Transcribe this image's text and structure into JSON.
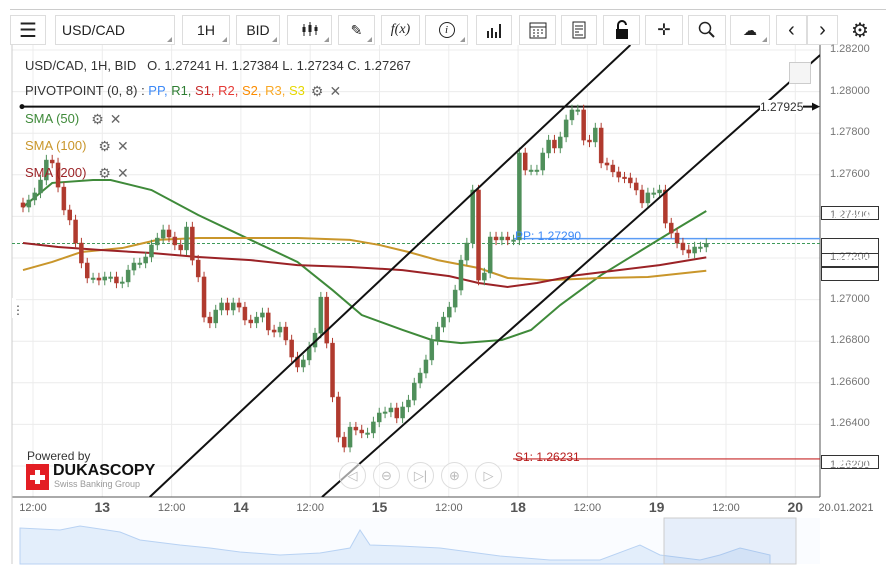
{
  "toolbar": {
    "symbol": "USD/CAD",
    "timeframe": "1H",
    "side": "BID",
    "icons": [
      "menu-icon",
      "candlestick-icon",
      "pencil-icon",
      "function-icon",
      "info-icon",
      "bar-chart-icon",
      "calendar-icon",
      "document-icon",
      "lock-icon",
      "crosshair-icon",
      "zoom-icon",
      "cloud-upload-icon",
      "chevron-left-icon",
      "chevron-right-icon",
      "gear-icon"
    ],
    "fx_label": "f(x)"
  },
  "legend": {
    "ohlc": "USD/CAD, 1H, BID   O. 1.27241 H. 1.27384 L. 1.27234 C. 1.27267",
    "pivot_label": "PIVOTPOINT (0, 8)",
    "pivot_sep": " : ",
    "pivot_items": [
      {
        "t": "PP",
        "c": "#3d8af7"
      },
      {
        "t": "R1",
        "c": "#2e7d32"
      },
      {
        "t": "S1",
        "c": "#c62828"
      },
      {
        "t": "R2",
        "c": "#e53935"
      },
      {
        "t": "S2",
        "c": "#fb8c00"
      },
      {
        "t": "R3",
        "c": "#f9a825"
      },
      {
        "t": "S3",
        "c": "#e6d800"
      }
    ],
    "sma": [
      {
        "label": "SMA (50)",
        "color": "#3f8a3a"
      },
      {
        "label": "SMA (100)",
        "color": "#c9962b"
      },
      {
        "label": "SMA (200)",
        "color": "#9b2226"
      }
    ]
  },
  "annotations": {
    "hline": "1.27925",
    "pp": "PP: 1.27290",
    "s1": "S1: 1.26231"
  },
  "price_axis": [
    "1.28200",
    "1.28000",
    "1.27800",
    "1.27600",
    "1.27400",
    "1.27200",
    "1.27000",
    "1.26800",
    "1.26600",
    "1.26400",
    "1.26200"
  ],
  "badges": [
    {
      "v": "1.27423",
      "c": "#3f7a38"
    },
    {
      "v": "1.27267",
      "c": "#6aa97a"
    },
    {
      "v": "1.27200",
      "c": "#8e1b1f"
    },
    {
      "v": "1.27136",
      "c": "#c0922f"
    },
    {
      "v": "1.26231",
      "c": "#a00000"
    }
  ],
  "time_axis": [
    {
      "t": "12:00",
      "big": false
    },
    {
      "t": "13",
      "big": true
    },
    {
      "t": "12:00",
      "big": false
    },
    {
      "t": "14",
      "big": true
    },
    {
      "t": "12:00",
      "big": false
    },
    {
      "t": "15",
      "big": true
    },
    {
      "t": "12:00",
      "big": false
    },
    {
      "t": "18",
      "big": true
    },
    {
      "t": "12:00",
      "big": false
    },
    {
      "t": "19",
      "big": true
    },
    {
      "t": "12:00",
      "big": false
    },
    {
      "t": "20",
      "big": true
    }
  ],
  "date_label": "20.01.2021",
  "branding": {
    "powered": "Powered by",
    "name": "DUKASCOPY",
    "sub": "Swiss Banking Group"
  },
  "nav_buttons": [
    "scroll-left",
    "zoom-out",
    "go-to-end",
    "zoom-in",
    "scroll-right"
  ],
  "chart_data": {
    "type": "candlestick",
    "symbol": "USD/CAD",
    "interval": "1H",
    "ylim": [
      1.26,
      1.2822
    ],
    "colors": {
      "up": "#4f8f5a",
      "down": "#b03a2e"
    },
    "closes": [
      1.27442,
      1.27476,
      1.2751,
      1.27572,
      1.27668,
      1.27654,
      1.27538,
      1.27428,
      1.2738,
      1.27269,
      1.27173,
      1.27101,
      1.27101,
      1.27091,
      1.27106,
      1.27106,
      1.27077,
      1.27082,
      1.27139,
      1.27173,
      1.27173,
      1.27202,
      1.2726,
      1.27293,
      1.27332,
      1.27298,
      1.2726,
      1.27236,
      1.27346,
      1.27187,
      1.27106,
      1.26913,
      1.26885,
      1.26947,
      1.26981,
      1.26947,
      1.26981,
      1.26961,
      1.26899,
      1.26885,
      1.26913,
      1.26933,
      1.26851,
      1.26841,
      1.26865,
      1.26803,
      1.26721,
      1.26673,
      1.26707,
      1.26769,
      1.26836,
      1.27009,
      1.26788,
      1.26529,
      1.26336,
      1.26288,
      1.26384,
      1.2637,
      1.26356,
      1.26356,
      1.26409,
      1.26452,
      1.26457,
      1.26476,
      1.26428,
      1.26481,
      1.26514,
      1.26596,
      1.26644,
      1.26707,
      1.26803,
      1.26865,
      1.26913,
      1.26961,
      1.27043,
      1.27187,
      1.27269,
      1.27524,
      1.27091,
      1.27125,
      1.27298,
      1.27284,
      1.27298,
      1.27284,
      1.27284,
      1.27702,
      1.2762,
      1.2762,
      1.2762,
      1.27702,
      1.27764,
      1.27726,
      1.27779,
      1.27861,
      1.27909,
      1.27909,
      1.27764,
      1.27755,
      1.27822,
      1.27654,
      1.27644,
      1.27611,
      1.27586,
      1.27582,
      1.27558,
      1.27524,
      1.27462,
      1.2751,
      1.2751,
      1.27524,
      1.27365,
      1.27317,
      1.27269,
      1.27236,
      1.27221,
      1.2725,
      1.2725,
      1.27267
    ],
    "sma": [
      {
        "name": "SMA (50)",
        "color": "#3f8a3a",
        "points": [
          [
            0,
            1.27442
          ],
          [
            5,
            1.27558
          ],
          [
            12,
            1.27572
          ],
          [
            15,
            1.27572
          ],
          [
            22,
            1.27524
          ],
          [
            30,
            1.27404
          ],
          [
            39,
            1.27284
          ],
          [
            47,
            1.27178
          ],
          [
            53,
            1.27043
          ],
          [
            58,
            1.26923
          ],
          [
            65,
            1.26851
          ],
          [
            70,
            1.26803
          ],
          [
            75,
            1.26788
          ],
          [
            82,
            1.26803
          ],
          [
            87,
            1.26851
          ],
          [
            92,
            1.26971
          ],
          [
            99,
            1.27115
          ],
          [
            106,
            1.27236
          ],
          [
            111,
            1.27322
          ],
          [
            117,
            1.27423
          ]
        ]
      },
      {
        "name": "SMA (100)",
        "color": "#c9962b",
        "points": [
          [
            0,
            1.27139
          ],
          [
            5,
            1.27178
          ],
          [
            10,
            1.27226
          ],
          [
            17,
            1.27245
          ],
          [
            23,
            1.27284
          ],
          [
            30,
            1.27293
          ],
          [
            39,
            1.27293
          ],
          [
            47,
            1.27293
          ],
          [
            56,
            1.27284
          ],
          [
            61,
            1.2726
          ],
          [
            66,
            1.27226
          ],
          [
            71,
            1.27187
          ],
          [
            78,
            1.27149
          ],
          [
            83,
            1.27101
          ],
          [
            90,
            1.27091
          ],
          [
            99,
            1.27101
          ],
          [
            107,
            1.27106
          ],
          [
            117,
            1.27136
          ]
        ]
      },
      {
        "name": "SMA (200)",
        "color": "#9b2226",
        "points": [
          [
            0,
            1.27269
          ],
          [
            6,
            1.2725
          ],
          [
            13,
            1.27236
          ],
          [
            22,
            1.27221
          ],
          [
            30,
            1.27202
          ],
          [
            39,
            1.27187
          ],
          [
            47,
            1.27163
          ],
          [
            56,
            1.27154
          ],
          [
            65,
            1.27139
          ],
          [
            73,
            1.2711
          ],
          [
            78,
            1.27077
          ],
          [
            83,
            1.27058
          ],
          [
            88,
            1.27077
          ],
          [
            95,
            1.27115
          ],
          [
            102,
            1.27139
          ],
          [
            109,
            1.27163
          ],
          [
            117,
            1.272
          ]
        ]
      }
    ],
    "channel": [
      [
        [
          21.7,
          1.26048
        ],
        [
          104,
          1.28221
        ]
      ],
      [
        [
          51.2,
          1.26048
        ],
        [
          136.5,
          1.28173
        ]
      ]
    ],
    "levels": {
      "horizontal": 1.27925,
      "pp": 1.2729,
      "s1": 1.26231,
      "last": 1.27267
    }
  }
}
